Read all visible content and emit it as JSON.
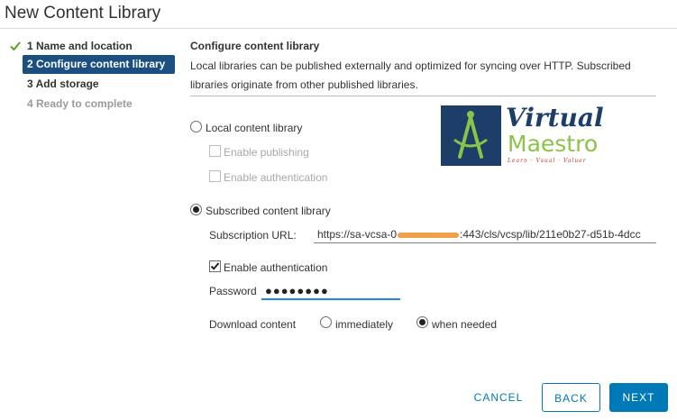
{
  "window": {
    "title": "New Content Library"
  },
  "steps": [
    {
      "label": "1 Name and location",
      "state": "complete"
    },
    {
      "label": "2 Configure content library",
      "state": "active"
    },
    {
      "label": "3 Add storage",
      "state": "pending"
    },
    {
      "label": "4 Ready to complete",
      "state": "disabled"
    }
  ],
  "main": {
    "heading": "Configure content library",
    "description": "Local libraries can be published externally and optimized for syncing over HTTP. Subscribed libraries originate from other published libraries.",
    "local": {
      "label": "Local content library",
      "selected": false,
      "enable_publishing": "Enable publishing",
      "enable_authentication": "Enable authentication"
    },
    "subscribed": {
      "label": "Subscribed content library",
      "selected": true,
      "url_label": "Subscription URL:",
      "url_prefix": "https://sa-vcsa-0",
      "url_suffix": ":443/cls/vcsp/lib/211e0b27-d51b-4dcc",
      "enable_authentication": "Enable authentication",
      "auth_checked": true,
      "password_label": "Password",
      "password_value": "●●●●●●●●",
      "download_label": "Download content",
      "option_immediately": "immediately",
      "option_when_needed": "when needed",
      "download_selected": "when needed"
    }
  },
  "logo": {
    "line1": "Virtual",
    "line2": "Maestro",
    "tagline": "Learn · Vsual · Valuer",
    "colors": {
      "navy": "#1d3e68",
      "green": "#8bc34a"
    }
  },
  "footer": {
    "cancel": "CANCEL",
    "back": "BACK",
    "next": "NEXT"
  },
  "colors": {
    "accent": "#0079b8",
    "active_step": "#1b4f82",
    "check": "#5aa220"
  }
}
